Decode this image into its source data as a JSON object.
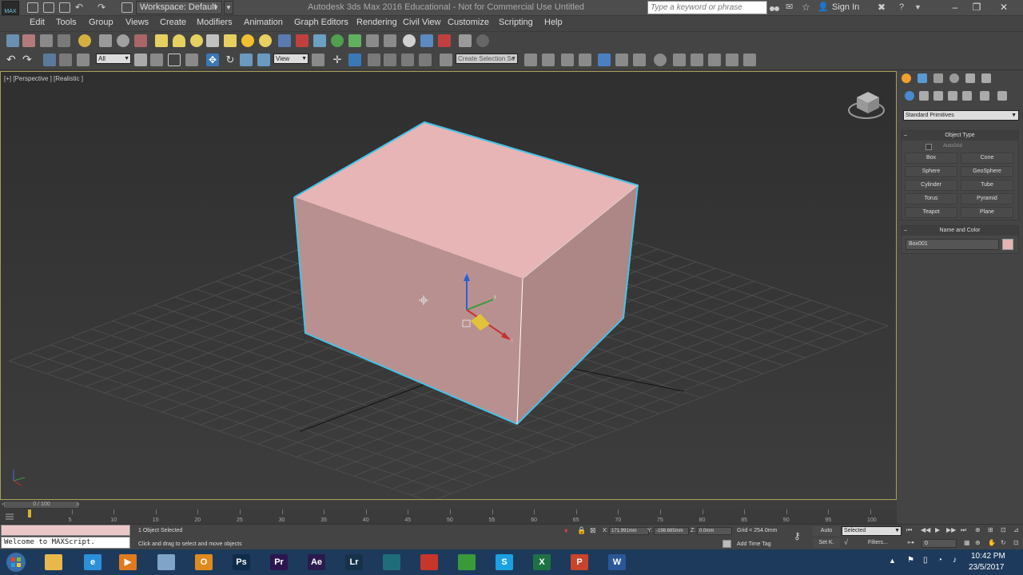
{
  "titlebar": {
    "app_logo": "MAX",
    "workspace": "Workspace: Default",
    "title": "Autodesk 3ds Max 2016 Educational   -  Not for Commercial Use    Untitled",
    "search_placeholder": "Type a keyword or phrase",
    "sign_in": "Sign In"
  },
  "menu": [
    "Edit",
    "Tools",
    "Group",
    "Views",
    "Create",
    "Modifiers",
    "Animation",
    "Graph Editors",
    "Rendering",
    "Civil View",
    "Customize",
    "Scripting",
    "Help"
  ],
  "toolbar": {
    "selection_filter": "All",
    "ref_coord": "View",
    "named_selection": "Create Selection Se"
  },
  "viewport": {
    "label": "[+] [Perspective ] [Realistic ]"
  },
  "command_panel": {
    "category": "Standard Primitives",
    "object_type_title": "Object Type",
    "autogrid": "AutoGrid",
    "buttons": [
      "Box",
      "Cone",
      "Sphere",
      "GeoSphere",
      "Cylinder",
      "Tube",
      "Torus",
      "Pyramid",
      "Teapot",
      "Plane"
    ],
    "name_color_title": "Name and Color",
    "object_name": "Box001",
    "object_color": "#e6b3b3"
  },
  "timeline": {
    "frame_display": "0 / 100",
    "ticks": [
      "0",
      "5",
      "10",
      "15",
      "20",
      "25",
      "30",
      "35",
      "40",
      "45",
      "50",
      "55",
      "60",
      "65",
      "70",
      "75",
      "80",
      "85",
      "90",
      "95",
      "100"
    ]
  },
  "status": {
    "maxscript": "Welcome to MAXScript.",
    "selection": "1 Object Selected",
    "prompt": "Click and drag to select and move objects",
    "x_label": "X:",
    "x_value": "171.991mm",
    "y_label": "Y:",
    "y_value": "-198.665mm",
    "z_label": "Z:",
    "z_value": "0.0mm",
    "grid": "Grid = 254.0mm",
    "add_time_tag": "Add Time Tag",
    "auto_key": "Auto",
    "set_key": "Set K.",
    "key_filter": "Selected",
    "filters": "Filters...",
    "current_frame": "0"
  },
  "taskbar": {
    "apps": [
      {
        "name": "file-explorer",
        "glyph": "",
        "color": "#e8b94a"
      },
      {
        "name": "internet-explorer",
        "glyph": "e",
        "color": "#2d8fd8"
      },
      {
        "name": "media-player",
        "glyph": "▶",
        "color": "#e07a1e"
      },
      {
        "name": "windows-explorer",
        "glyph": "",
        "color": "#7fa4c8"
      },
      {
        "name": "outlook",
        "glyph": "O",
        "color": "#e08a1e"
      },
      {
        "name": "photoshop",
        "glyph": "Ps",
        "color": "#0f2c4a"
      },
      {
        "name": "premiere",
        "glyph": "Pr",
        "color": "#2b1650"
      },
      {
        "name": "after-effects",
        "glyph": "Ae",
        "color": "#2a1a4e"
      },
      {
        "name": "lightroom",
        "glyph": "Lr",
        "color": "#16324a"
      },
      {
        "name": "3ds-max",
        "glyph": "",
        "color": "#1f6d7a"
      },
      {
        "name": "sketchup",
        "glyph": "",
        "color": "#c8352b"
      },
      {
        "name": "chrome",
        "glyph": "",
        "color": "#3a9a3a"
      },
      {
        "name": "skype",
        "glyph": "S",
        "color": "#1aa1e1"
      },
      {
        "name": "excel",
        "glyph": "X",
        "color": "#1e7145"
      },
      {
        "name": "powerpoint",
        "glyph": "P",
        "color": "#c9442a"
      },
      {
        "name": "word",
        "glyph": "W",
        "color": "#2b5797"
      }
    ],
    "time": "10:42 PM",
    "date": "23/5/2017"
  },
  "colors": {
    "box_top": "#e7b5b5",
    "box_front": "#b99090",
    "box_right": "#ad8686",
    "selection_outline": "#48c2e6",
    "viewport_border": "#a89c58"
  }
}
